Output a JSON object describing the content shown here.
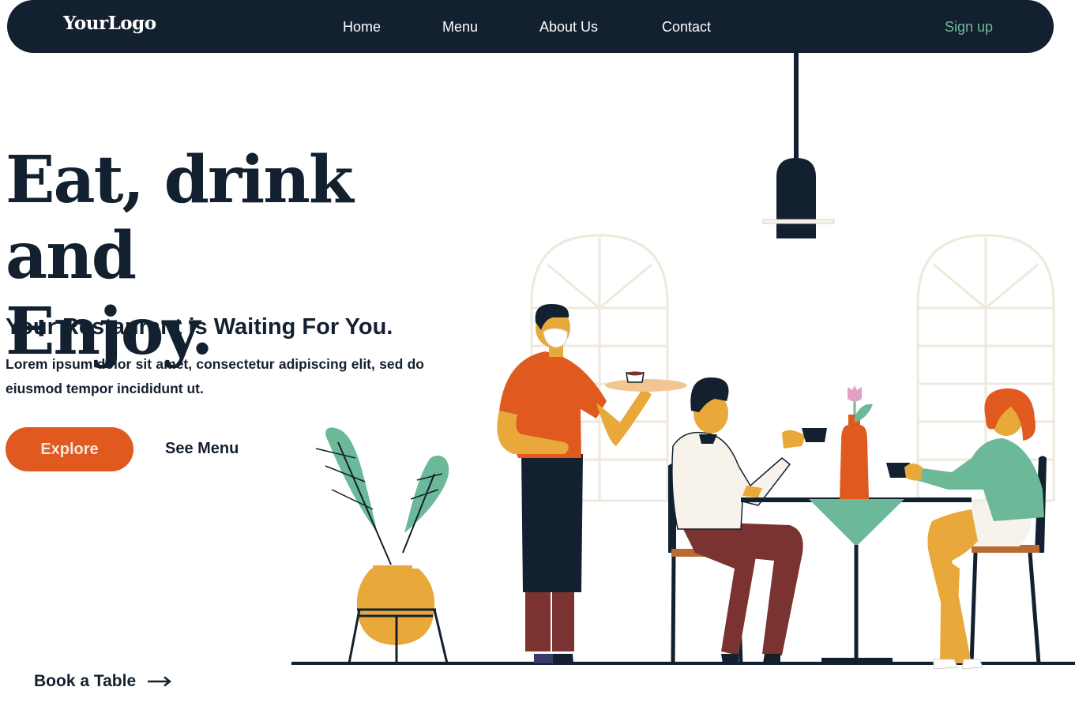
{
  "nav": {
    "logo": "YourLogo",
    "links": [
      "Home",
      "Menu",
      "About Us",
      "Contact"
    ],
    "signup": "Sign up"
  },
  "hero": {
    "title_line1": "Eat, drink and",
    "title_line2": "Enjoy.",
    "subtitle": "Your Restaurant is Waiting For You.",
    "body": "Lorem ipsum dolor sit amet, consectetur adipiscing elit, sed do eiusmod tempor incididunt ut.",
    "explore_label": "Explore",
    "see_menu_label": "See Menu",
    "book_label": "Book a Table"
  },
  "icons": {
    "arrow": "arrow-right-icon"
  },
  "colors": {
    "navy": "#132030",
    "orange": "#e05a20",
    "green": "#6cb99a",
    "mustard": "#e8a83a",
    "maroon": "#7a3330",
    "cream": "#f7f3ea"
  }
}
